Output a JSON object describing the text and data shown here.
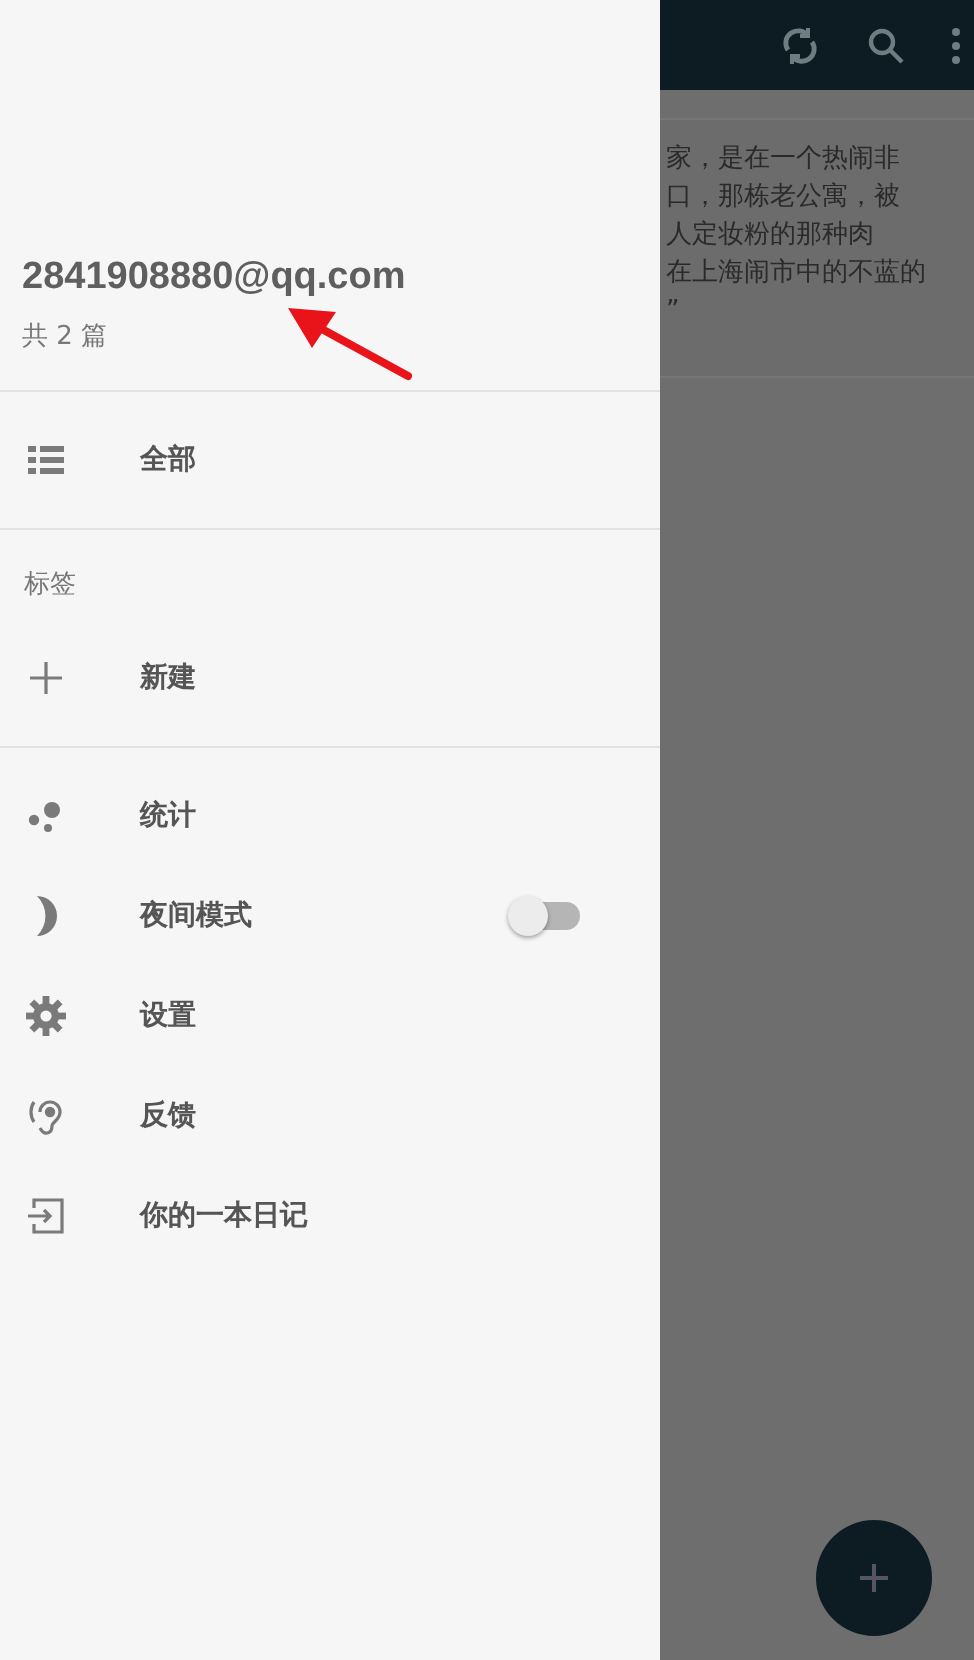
{
  "drawer": {
    "email": "2841908880@qq.com",
    "count": "共 2 篇",
    "sections": [
      {
        "items": [
          {
            "kind": "link",
            "label": "全部"
          }
        ]
      },
      {
        "heading": "标签",
        "items": [
          {
            "kind": "link",
            "label": "新建"
          }
        ]
      },
      {
        "items": [
          {
            "kind": "link",
            "label": "统计"
          },
          {
            "kind": "toggle",
            "label": "夜间模式",
            "on": false
          },
          {
            "kind": "link",
            "label": "设置"
          },
          {
            "kind": "link",
            "label": "反馈"
          },
          {
            "kind": "link",
            "label": "你的一本日记"
          }
        ]
      }
    ]
  },
  "card": {
    "lines": [
      "家，是在一个热闹非",
      "口，那栋老公寓，被",
      "人定妆粉的那种肉",
      "在上海闹市中的不蓝的",
      "”"
    ]
  }
}
